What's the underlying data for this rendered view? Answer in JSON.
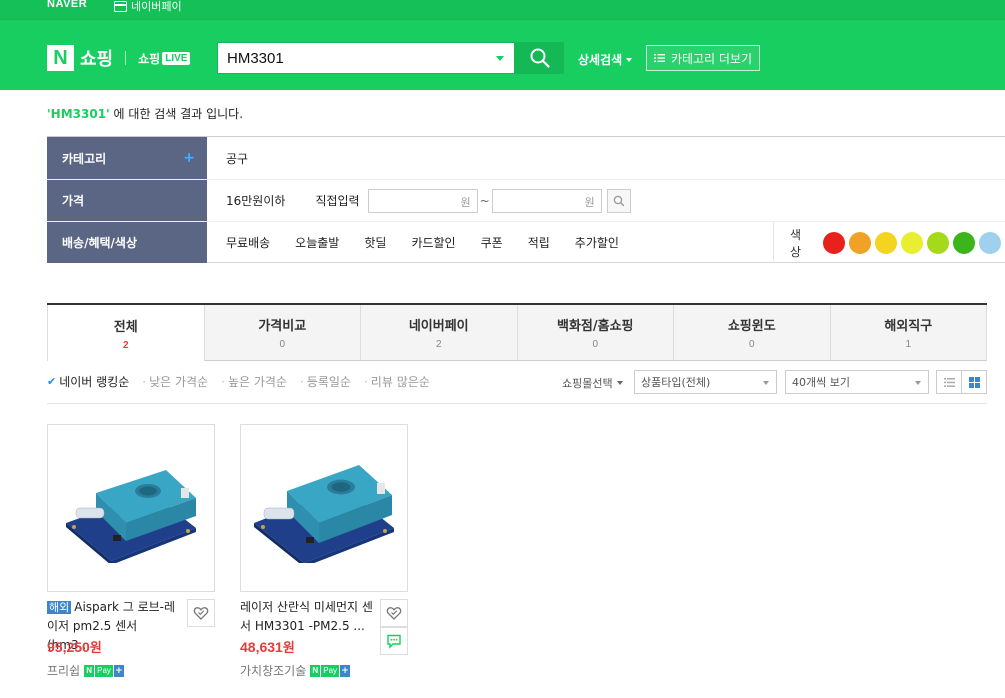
{
  "gnb": {
    "logo": "NAVER",
    "npay_label": "네이버페이"
  },
  "brand": {
    "n": "N",
    "shopping": "쇼핑",
    "live_prefix": "쇼핑",
    "live_badge": "LIVE"
  },
  "search": {
    "query": "HM3301"
  },
  "header": {
    "detail_search": "상세검색",
    "category_more": "카테고리 더보기"
  },
  "result_message": {
    "keyword": "'HM3301'",
    "suffix": " 에 대한 검색 결과 입니다."
  },
  "filters": {
    "category": {
      "label": "카테고리",
      "plus": "+",
      "value": "공구"
    },
    "price": {
      "label": "가격",
      "preset": "16만원이하",
      "direct_label": "직접입력",
      "unit": "원",
      "tilde": "~"
    },
    "benefit": {
      "label": "배송/혜택/색상",
      "items": [
        "무료배송",
        "오늘출발",
        "핫딜",
        "카드할인",
        "쿠폰",
        "적립",
        "추가할인"
      ],
      "color_label": "색상",
      "colors": [
        "#e8211d",
        "#f0a226",
        "#f4d321",
        "#e7ef30",
        "#a4d91c",
        "#3cb41c",
        "#9fd0ee"
      ]
    }
  },
  "tabs": [
    {
      "label": "전체",
      "count": "2",
      "active": true
    },
    {
      "label": "가격비교",
      "count": "0"
    },
    {
      "label": "네이버페이",
      "count": "2"
    },
    {
      "label": "백화점/홈쇼핑",
      "count": "0"
    },
    {
      "label": "쇼핑윈도",
      "count": "0"
    },
    {
      "label": "해외직구",
      "count": "1"
    }
  ],
  "sort": {
    "check": "✔",
    "options": [
      "네이버 랭킹순",
      "낮은 가격순",
      "높은 가격순",
      "등록일순",
      "리뷰 많은순"
    ],
    "mall_select": "쇼핑몰선택",
    "product_type": "상품타입(전체)",
    "per_page": "40개씩 보기"
  },
  "products": [
    {
      "badge": "해외",
      "title": "Aispark 그 로브-레이저 pm2.5 센서 (hm3...",
      "price": "95,250",
      "won": "원",
      "seller": "프리쉽",
      "npay": {
        "n": "N",
        "pay": "Pay",
        "plus": "+"
      }
    },
    {
      "title": "레이저 산란식 미세먼지 센서 HM3301 -PM2.5 ...",
      "price": "48,631",
      "won": "원",
      "seller": "가치창조기술",
      "npay": {
        "n": "N",
        "pay": "Pay",
        "plus": "+"
      }
    }
  ],
  "icons": {
    "npay": "card-icon",
    "search": "search-icon",
    "category_list": "list-icon",
    "list_view": "list-view-icon",
    "grid_view": "grid-view-icon",
    "zzim": "heart-icon",
    "talk": "talk-icon"
  },
  "colors": {
    "brand_green": "#19ce60",
    "label_bg": "#5a6683",
    "price_red": "#e63b3b",
    "overseas_blue": "#3f85c9"
  }
}
